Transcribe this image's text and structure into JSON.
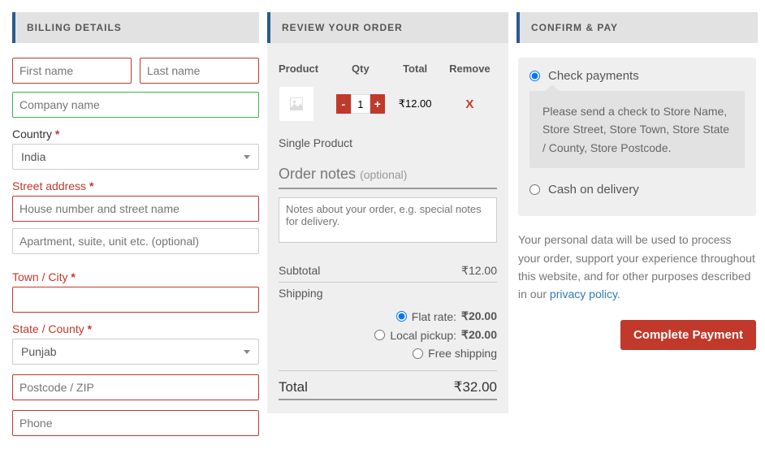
{
  "billing": {
    "header": "BILLING DETAILS",
    "first_name_ph": "First name",
    "last_name_ph": "Last name",
    "company_ph": "Company name",
    "country_label": "Country",
    "country_value": "India",
    "street_label": "Street address",
    "street1_ph": "House number and street name",
    "street2_ph": "Apartment, suite, unit etc. (optional)",
    "town_label": "Town / City",
    "state_label": "State / County",
    "state_value": "Punjab",
    "postcode_ph": "Postcode / ZIP",
    "phone_ph": "Phone",
    "req": "*"
  },
  "review": {
    "header": "REVIEW YOUR ORDER",
    "cols": {
      "product": "Product",
      "qty": "Qty",
      "total": "Total",
      "remove": "Remove"
    },
    "item": {
      "qty": "1",
      "total": "₹12.00",
      "remove": "X",
      "name": "Single Product"
    },
    "notes_label": "Order notes",
    "notes_optional": "(optional)",
    "notes_ph": "Notes about your order, e.g. special notes for delivery.",
    "subtotal_label": "Subtotal",
    "subtotal_value": "₹12.00",
    "shipping_label": "Shipping",
    "shipping": {
      "flat": {
        "label": "Flat rate:",
        "price": "₹20.00"
      },
      "local": {
        "label": "Local pickup:",
        "price": "₹20.00"
      },
      "free": {
        "label": "Free shipping"
      }
    },
    "total_label": "Total",
    "total_value": "₹32.00"
  },
  "confirm": {
    "header": "CONFIRM & PAY",
    "check_label": "Check payments",
    "check_desc": "Please send a check to Store Name, Store Street, Store Town, Store State / County, Store Postcode.",
    "cod_label": "Cash on delivery",
    "privacy_text": "Your personal data will be used to process your order, support your experience throughout this website, and for other purposes described in our ",
    "privacy_link": "privacy policy",
    "privacy_dot": ".",
    "button": "Complete Payment"
  }
}
